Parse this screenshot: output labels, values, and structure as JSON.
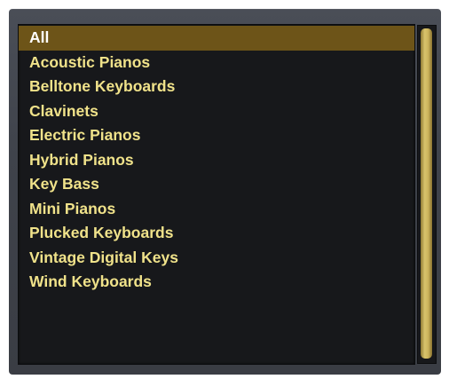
{
  "list": {
    "selected_index": 0,
    "items": [
      {
        "label": "All"
      },
      {
        "label": "Acoustic Pianos"
      },
      {
        "label": "Belltone Keyboards"
      },
      {
        "label": "Clavinets"
      },
      {
        "label": "Electric Pianos"
      },
      {
        "label": "Hybrid Pianos"
      },
      {
        "label": "Key Bass"
      },
      {
        "label": "Mini Pianos"
      },
      {
        "label": "Plucked Keyboards"
      },
      {
        "label": "Vintage Digital Keys"
      },
      {
        "label": "Wind Keyboards"
      }
    ]
  },
  "colors": {
    "panel_background": "#17181b",
    "frame_background": "#41454c",
    "item_text": "#f0e28a",
    "selected_background": "#6d5418",
    "selected_text": "#ffffff",
    "scrollbar_thumb": "#cdb55c"
  }
}
